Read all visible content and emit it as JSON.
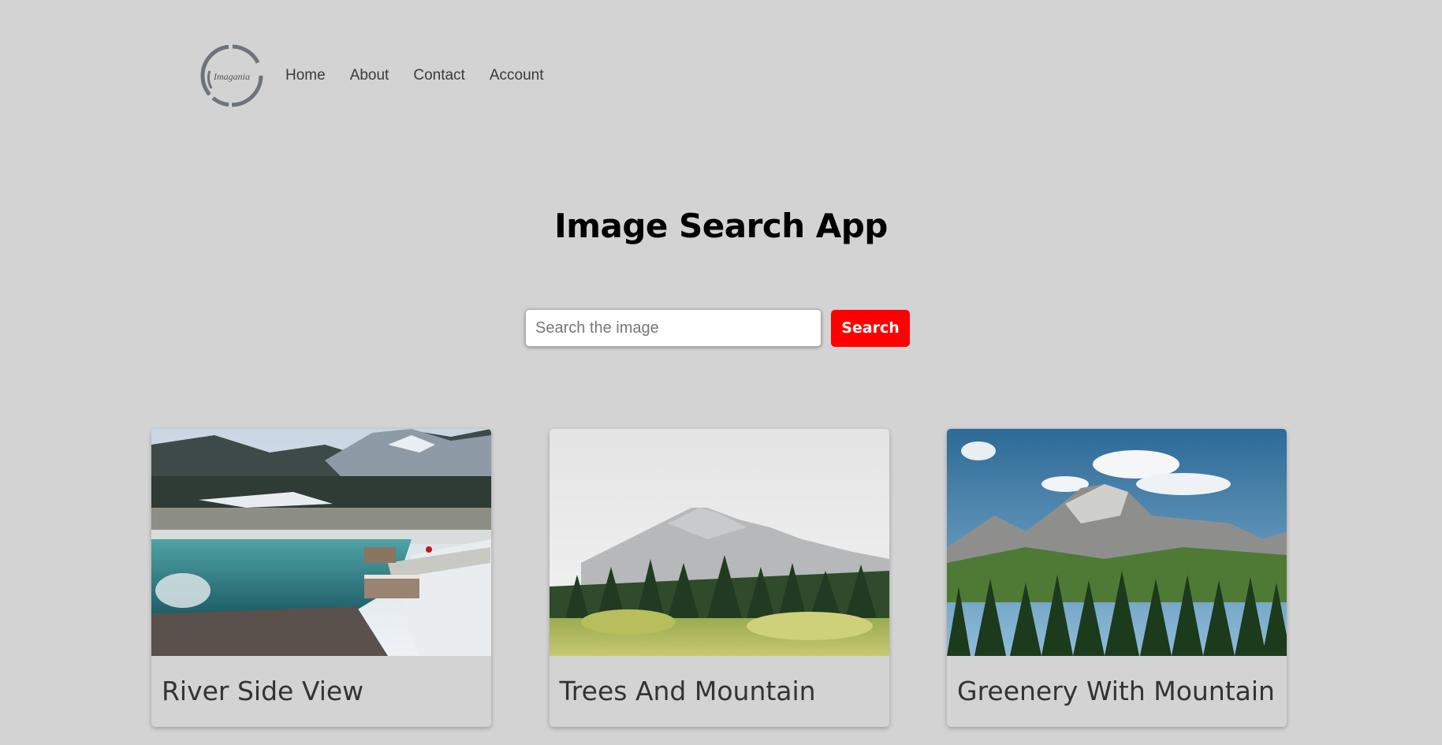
{
  "header": {
    "logo": {
      "text": "Imagania",
      "icon": "circle-brush-logo"
    },
    "nav": [
      {
        "label": "Home"
      },
      {
        "label": "About"
      },
      {
        "label": "Contact"
      },
      {
        "label": "Account"
      }
    ]
  },
  "main": {
    "title": "Image Search App",
    "search": {
      "placeholder": "Search the image",
      "value": "",
      "button_label": "Search"
    },
    "results": [
      {
        "title": "River Side View",
        "image": "snowy-river-dock-photo"
      },
      {
        "title": "Trees And Mountain",
        "image": "misty-mountain-forest-photo"
      },
      {
        "title": "Greenery With Mountain",
        "image": "alpine-peak-blue-sky-photo"
      }
    ]
  },
  "colors": {
    "background": "#d3d3d3",
    "accent": "#ff0000",
    "text": "#333333"
  }
}
